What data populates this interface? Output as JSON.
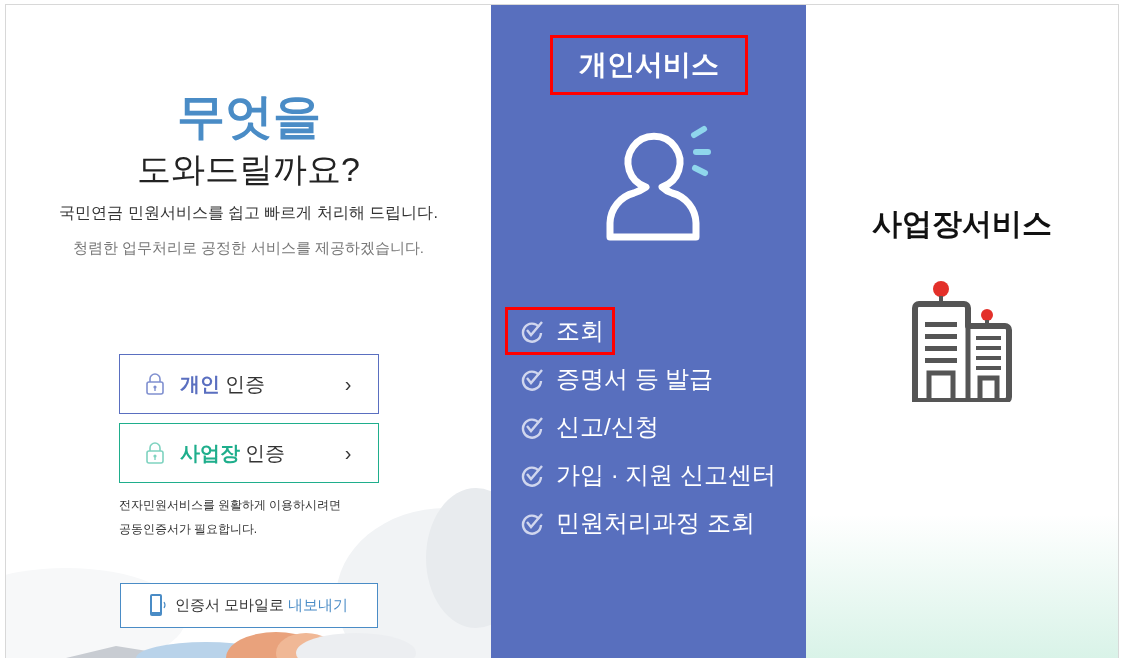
{
  "intro": {
    "title": "무엇을",
    "subtitle": "도와드릴까요?",
    "line_1": "국민연금 민원서비스를 쉽고 빠르게 처리해 드립니다.",
    "line_2": "청렴한 업무처리로 공정한 서비스를 제공하겠습니다."
  },
  "auth_buttons": [
    {
      "label": "**개인** 인증",
      "kind": "personal",
      "arrow": "›"
    },
    {
      "label": "**사업장** 인증",
      "kind": "business",
      "arrow": "›"
    }
  ],
  "auth_note": "전자민원서비스를 원활하게 이용하시려면 공동인증서가 필요합니다.",
  "mobile_button": {
    "label": "**인증서 모바일로** 내보내기"
  },
  "personal_service": {
    "title": "개인서비스",
    "highlighted": true,
    "items": [
      {
        "label": "조회",
        "highlighted": true
      },
      {
        "label": "증명서 등 발급",
        "highlighted": false
      },
      {
        "label": "신고/신청",
        "highlighted": false
      },
      {
        "label": "가입 · 지원 신고센터",
        "highlighted": false
      },
      {
        "label": "민원처리과정 조회",
        "highlighted": false
      }
    ]
  },
  "business_service": {
    "title": "사업장서비스"
  }
}
